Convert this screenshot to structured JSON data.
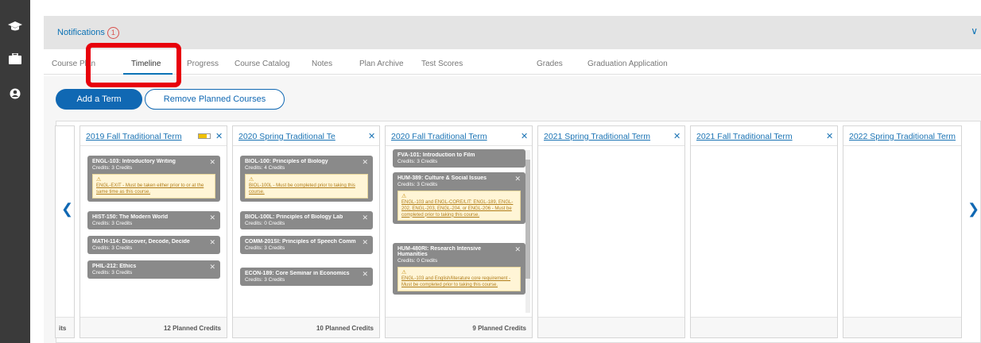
{
  "sidebar": {
    "icons": [
      "graduation-cap-icon",
      "briefcase-icon",
      "user-icon"
    ]
  },
  "notifications": {
    "label": "Notifications",
    "count": "1"
  },
  "tabs": [
    {
      "label": "Course Plan"
    },
    {
      "label": "Timeline"
    },
    {
      "label": "Progress"
    },
    {
      "label": "Course Catalog"
    },
    {
      "label": "Notes"
    },
    {
      "label": "Plan Archive"
    },
    {
      "label": "Test Scores"
    },
    {
      "label": "Grades"
    },
    {
      "label": "Graduation Application"
    }
  ],
  "actions": {
    "add_term": "Add a Term",
    "remove_planned": "Remove Planned Courses"
  },
  "left_partial": {
    "footer": "its"
  },
  "terms": [
    {
      "title": "2019 Fall Traditional Term",
      "footer": "12 Planned Credits",
      "courses": [
        {
          "title": "ENGL-103: Introductory Writing",
          "credits": "Credits: 3 Credits",
          "warning": "ENGL-EXIT - Must be taken either prior to or at the same time as this course."
        },
        {
          "title": "HIST-150: The Modern World",
          "credits": "Credits: 3 Credits"
        },
        {
          "title": "MATH-114: Discover, Decode, Decide",
          "credits": "Credits: 3 Credits"
        },
        {
          "title": "PHIL-212: Ethics",
          "credits": "Credits: 3 Credits"
        }
      ]
    },
    {
      "title": "2020 Spring Traditional Te",
      "footer": "10 Planned Credits",
      "courses": [
        {
          "title": "BIOL-100: Principles of Biology",
          "credits": "Credits: 4 Credits",
          "warning": "BIOL-100L - Must be completed prior to taking this course."
        },
        {
          "title": "BIOL-100L: Principles of Biology Lab",
          "credits": "Credits: 0 Credits"
        },
        {
          "title": "COMM-201SI: Principles of Speech Comm",
          "credits": "Credits: 3 Credits"
        },
        {
          "title": "ECON-189: Core Seminar in Economics",
          "credits": "Credits: 3 Credits"
        }
      ]
    },
    {
      "title": "2020 Fall Traditional Term",
      "footer": "9 Planned Credits",
      "courses": [
        {
          "title": "FVA-101: Introduction to Film",
          "credits": "Credits: 3 Credits"
        },
        {
          "title": "HUM-389: Culture & Social Issues",
          "credits": "Credits: 3 Credits",
          "warning": "ENGL-103 and ENGL-CORE/LIT: ENGL-189, ENGL-202, ENGL-203, ENGL-204, or ENGL-206 - Must be completed prior to taking this course."
        },
        {
          "title": "HUM-480RI: Research Intensive Humanities",
          "credits": "Credits: 0 Credits",
          "warning": "ENGL-103 and English/literature core requirement - Must be completed prior to taking this course."
        }
      ]
    },
    {
      "title": "2021 Spring Traditional Term",
      "footer": ""
    },
    {
      "title": "2021 Fall Traditional Term",
      "footer": ""
    },
    {
      "title": "2022 Spring Traditional Term",
      "footer": ""
    }
  ]
}
